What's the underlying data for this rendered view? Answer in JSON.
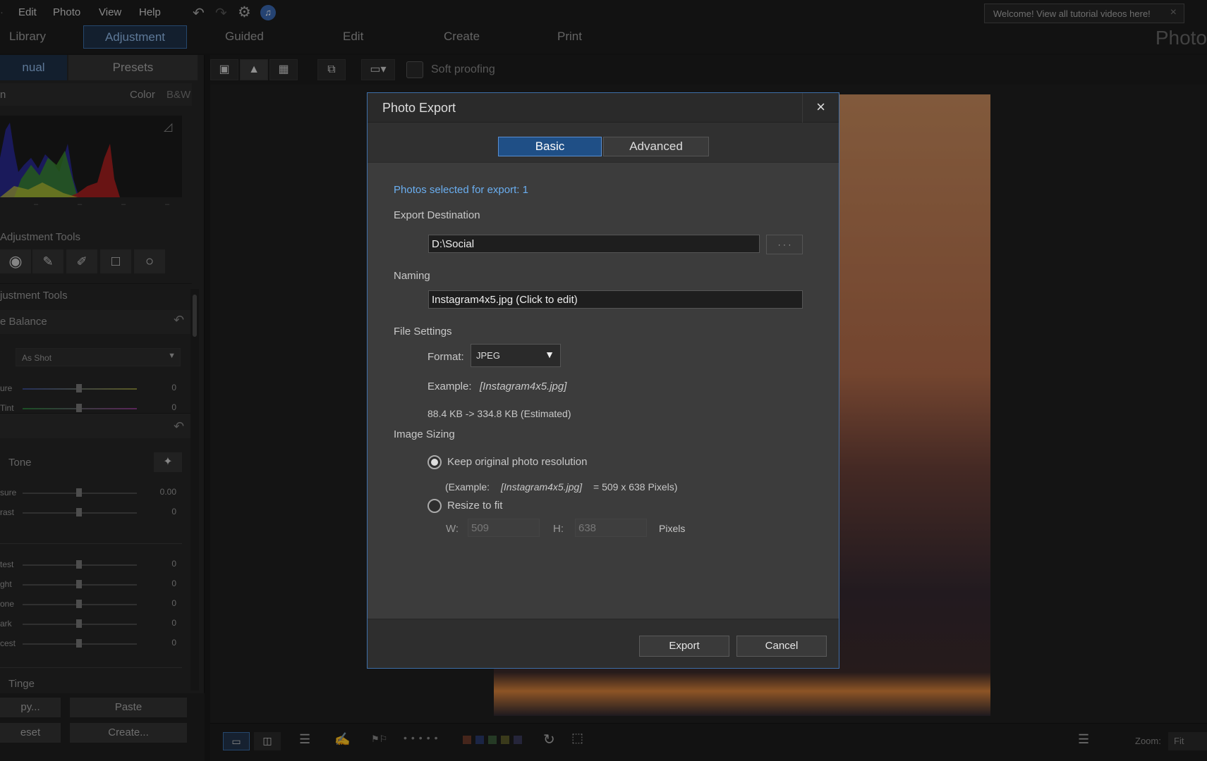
{
  "menu": {
    "items": [
      "Edit",
      "Photo",
      "View",
      "Help"
    ]
  },
  "welcome": {
    "text": "Welcome! View all tutorial videos here!"
  },
  "modules": {
    "library": "Library",
    "adjustment": "Adjustment",
    "guided": "Guided",
    "edit": "Edit",
    "create": "Create",
    "print": "Print",
    "brand": "Photo"
  },
  "leftpanel": {
    "tab_manual": "nual",
    "tab_presets": "Presets",
    "hist_header": "n",
    "color": "Color",
    "bw": "B&W",
    "regional_tools": "Adjustment Tools",
    "global_tools": "justment Tools",
    "wb": "e Balance",
    "as_shot": "As Shot",
    "tone": "Tone",
    "tinge": "Tinge",
    "sliders": [
      {
        "label": "ure",
        "value": "0"
      },
      {
        "label": "Tint",
        "value": "0"
      },
      {
        "label": "sure",
        "value": "0.00"
      },
      {
        "label": "rast",
        "value": "0"
      },
      {
        "label": "test",
        "value": "0"
      },
      {
        "label": "ght",
        "value": "0"
      },
      {
        "label": "one",
        "value": "0"
      },
      {
        "label": "ark",
        "value": "0"
      },
      {
        "label": "cest",
        "value": "0"
      }
    ],
    "copy": "py...",
    "paste": "Paste",
    "reset": "eset",
    "create": "Create..."
  },
  "toolbar": {
    "soft_proofing": "Soft proofing"
  },
  "bottombar": {
    "zoom_label": "Zoom:",
    "zoom_value": "Fit"
  },
  "dialog": {
    "title": "Photo Export",
    "close": "×",
    "tab_basic": "Basic",
    "tab_advanced": "Advanced",
    "selected": "Photos selected for export: 1",
    "dest_label": "Export Destination",
    "dest_value": "D:\\Social",
    "browse": "· · ·",
    "naming_label": "Naming",
    "naming_value": "Instagram4x5.jpg  (Click to edit)",
    "file_settings": "File Settings",
    "format_label": "Format:",
    "format_value": "JPEG",
    "example_label": "Example:",
    "example_value": "[Instagram4x5.jpg]",
    "size_estimate": "88.4 KB -> 334.8 KB (Estimated)",
    "image_sizing": "Image Sizing",
    "keep_original": "Keep original photo resolution",
    "keep_example_prefix": "(Example:",
    "keep_example_file": "[Instagram4x5.jpg]",
    "keep_example_suffix": "= 509 x 638  Pixels)",
    "resize_to_fit": "Resize to fit",
    "w_label": "W:",
    "w_value": "509",
    "h_label": "H:",
    "h_value": "638",
    "pixels": "Pixels",
    "export": "Export",
    "cancel": "Cancel"
  },
  "colors": {
    "accent": "#1f4f86",
    "selected_text": "#6aaef0"
  }
}
